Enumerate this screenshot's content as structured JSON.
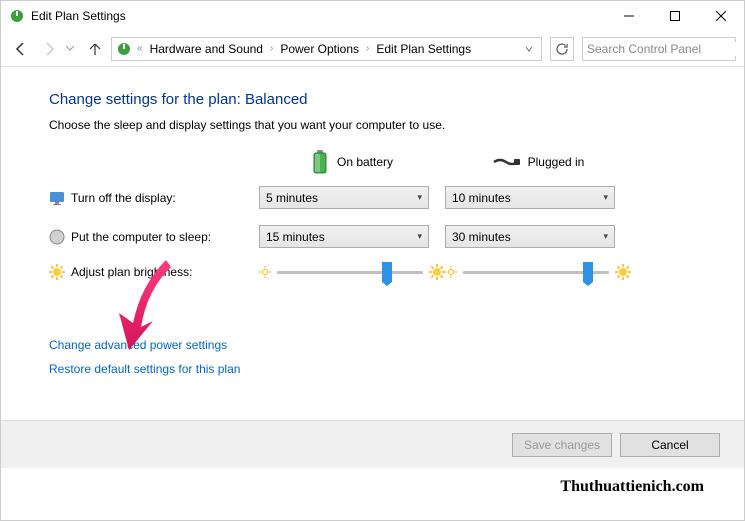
{
  "window": {
    "title": "Edit Plan Settings"
  },
  "breadcrumb": {
    "items": [
      "Hardware and Sound",
      "Power Options",
      "Edit Plan Settings"
    ]
  },
  "search": {
    "placeholder": "Search Control Panel"
  },
  "page": {
    "title": "Change settings for the plan: Balanced",
    "subtitle": "Choose the sleep and display settings that you want your computer to use."
  },
  "columns": {
    "battery": "On battery",
    "plugged": "Plugged in"
  },
  "settings": {
    "display": {
      "label": "Turn off the display:",
      "battery": "5 minutes",
      "plugged": "10 minutes"
    },
    "sleep": {
      "label": "Put the computer to sleep:",
      "battery": "15 minutes",
      "plugged": "30 minutes"
    },
    "brightness": {
      "label": "Adjust plan brightness:"
    }
  },
  "links": {
    "advanced": "Change advanced power settings",
    "restore": "Restore default settings for this plan"
  },
  "footer": {
    "save": "Save changes",
    "cancel": "Cancel"
  },
  "watermark": "Thuthuattienich.com"
}
